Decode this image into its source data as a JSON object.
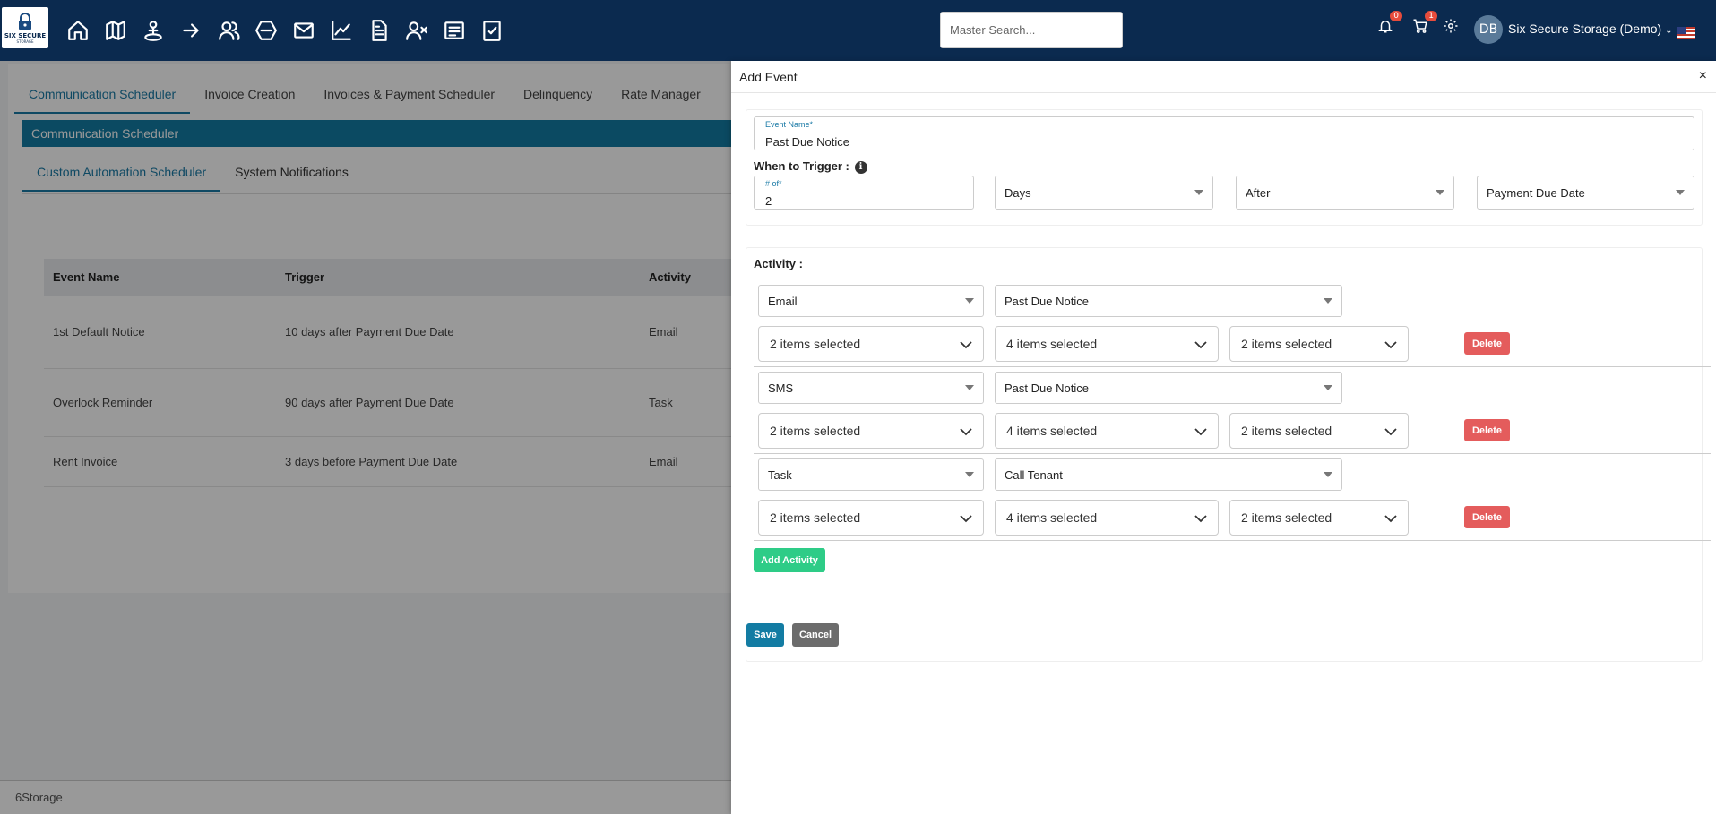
{
  "header": {
    "logo_text": "SIX SECURE",
    "logo_subtext": "STORAGE",
    "nav_icons": [
      "home-icon",
      "map-icon",
      "person-pin-icon",
      "arrow-right-icon",
      "users-icon",
      "hexagon-icon",
      "mail-icon",
      "chart-icon",
      "document-icon",
      "user-remove-icon",
      "list-icon",
      "checklist-icon"
    ],
    "search_placeholder": "Master Search...",
    "notifications_count": "0",
    "cart_count": "1",
    "avatar_initials": "DB",
    "company": "Six Secure Storage (Demo)"
  },
  "background": {
    "tabs": [
      "Communication Scheduler",
      "Invoice Creation",
      "Invoices & Payment Scheduler",
      "Delinquency",
      "Rate Manager"
    ],
    "section_title": "Communication Scheduler",
    "subtabs": [
      "Custom Automation Scheduler",
      "System Notifications"
    ],
    "table": {
      "headers": [
        "Event Name",
        "Trigger",
        "Activity"
      ],
      "rows": [
        [
          "1st Default Notice",
          "10 days after Payment Due Date",
          "Email"
        ],
        [
          "Overlock Reminder",
          "90 days after Payment Due Date",
          "Task"
        ],
        [
          "Rent Invoice",
          "3 days before Payment Due Date",
          "Email"
        ]
      ]
    },
    "footer": "6Storage"
  },
  "drawer": {
    "title": "Add Event",
    "close": "×",
    "event_name_label": "Event Name*",
    "event_name_value": "Past Due Notice",
    "when_to_trigger_label": "When to Trigger :",
    "info": "i",
    "count_label": "# of*",
    "count_value": "2",
    "unit": "Days",
    "direction": "After",
    "reference": "Payment Due Date",
    "activity_label": "Activity :",
    "activities": [
      {
        "type": "Email",
        "template": "Past Due Notice",
        "m1": "2 items selected",
        "m2": "4 items selected",
        "m3": "2 items selected",
        "delete": "Delete"
      },
      {
        "type": "SMS",
        "template": "Past Due Notice",
        "m1": "2 items selected",
        "m2": "4 items selected",
        "m3": "2 items selected",
        "delete": "Delete"
      },
      {
        "type": "Task",
        "template": "Call Tenant",
        "m1": "2 items selected",
        "m2": "4 items selected",
        "m3": "2 items selected",
        "delete": "Delete"
      }
    ],
    "add_activity": "Add Activity",
    "save": "Save",
    "cancel": "Cancel"
  },
  "colors": {
    "topbar": "#0b2a4f",
    "accent": "#1a7aa6",
    "delete": "#e45c5c",
    "add_activity": "#2ecc87",
    "save": "#137ca3",
    "cancel": "#6c6c6c"
  }
}
